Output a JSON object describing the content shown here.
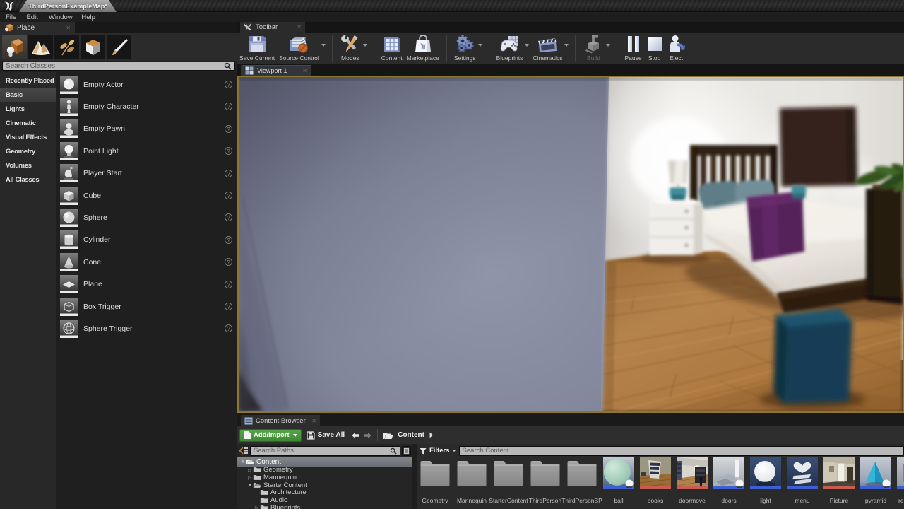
{
  "window": {
    "doc_tab": "ThirdPersonExampleMap*",
    "menu": [
      "File",
      "Edit",
      "Window",
      "Help"
    ]
  },
  "place_panel": {
    "tab": "Place",
    "search_placeholder": "Search Classes",
    "categories": [
      "Recently Placed",
      "Basic",
      "Lights",
      "Cinematic",
      "Visual Effects",
      "Geometry",
      "Volumes",
      "All Classes"
    ],
    "selected_category": "Basic",
    "items": [
      "Empty Actor",
      "Empty Character",
      "Empty Pawn",
      "Point Light",
      "Player Start",
      "Cube",
      "Sphere",
      "Cylinder",
      "Cone",
      "Plane",
      "Box Trigger",
      "Sphere Trigger"
    ]
  },
  "toolbar": {
    "tab": "Toolbar",
    "buttons": {
      "save_current": "Save Current",
      "source_control": "Source Control",
      "modes": "Modes",
      "content": "Content",
      "marketplace": "Marketplace",
      "settings": "Settings",
      "blueprints": "Blueprints",
      "cinematics": "Cinematics",
      "build": "Build",
      "pause": "Pause",
      "stop": "Stop",
      "eject": "Eject"
    }
  },
  "viewport": {
    "tab": "Viewport 1"
  },
  "content_browser": {
    "tab": "Content Browser",
    "add_import": "Add/Import",
    "save_all": "Save All",
    "breadcrumb": "Content",
    "search_paths_placeholder": "Search Paths",
    "filters": "Filters",
    "search_content_placeholder": "Search Content",
    "tree": {
      "root": "Content",
      "child0": "Geometry",
      "child1": "Mannequin",
      "child2": "StarterContent",
      "sub0": "Architecture",
      "sub1": "Audio",
      "sub2": "Blueprints"
    },
    "folders": [
      "Geometry",
      "Mannequin",
      "StarterContent",
      "ThirdPerson",
      "ThirdPersonBP"
    ],
    "assets": [
      "ball",
      "books",
      "doormove",
      "doors",
      "light",
      "menu",
      "Picture",
      "pyramid",
      "re"
    ]
  },
  "colors": {
    "accent_green": "#4a9a3e",
    "gold_border": "#8e762c",
    "strip_blueprint": "#3f5fd0",
    "strip_level": "#c65c52"
  }
}
